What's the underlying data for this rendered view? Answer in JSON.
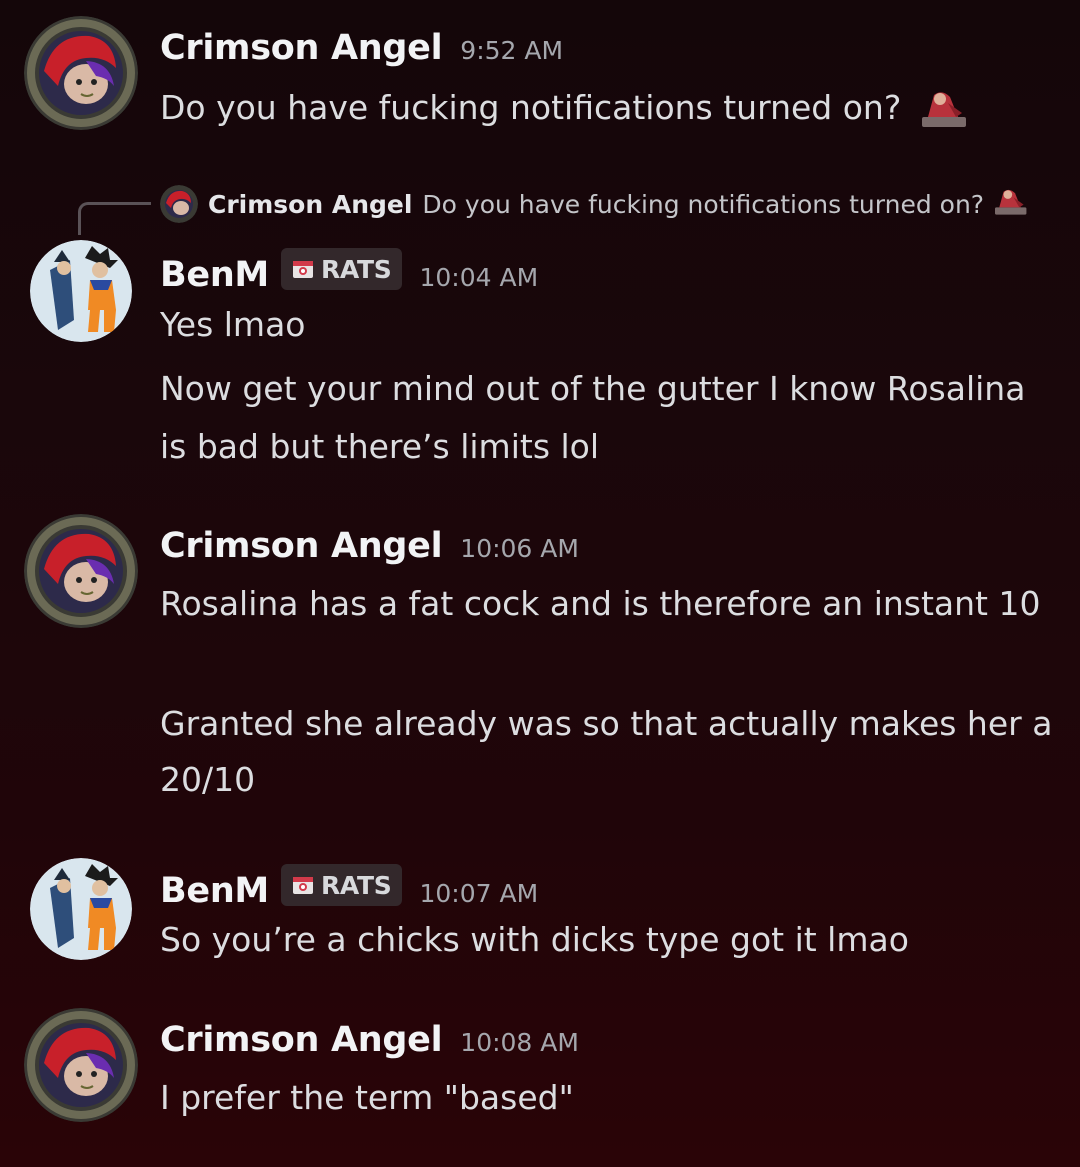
{
  "messages": [
    {
      "author": "Crimson Angel",
      "time": "9:52 AM",
      "lines": [
        "Do you have fucking notifications turned on?"
      ],
      "emoji": "figure-sticker-icon"
    },
    {
      "reply_to": {
        "author": "Crimson Angel",
        "text": "Do you have fucking notifications turned on?"
      },
      "author": "BenM",
      "role_tag": "RATS",
      "time": "10:04 AM",
      "lines": [
        "Yes lmao",
        "Now get your mind out of the gutter I know Rosalina is bad but there’s limits lol"
      ]
    },
    {
      "author": "Crimson Angel",
      "time": "10:06 AM",
      "lines": [
        "Rosalina has a fat cock and is therefore an instant 10",
        "Granted she already was so that actually makes her a 20/10"
      ]
    },
    {
      "author": "BenM",
      "role_tag": "RATS",
      "time": "10:07 AM",
      "lines": [
        "So you’re a chicks with dicks type got it lmao"
      ]
    },
    {
      "author": "Crimson Angel",
      "time": "10:08 AM",
      "lines": [
        "I prefer the term \"based\""
      ]
    }
  ]
}
